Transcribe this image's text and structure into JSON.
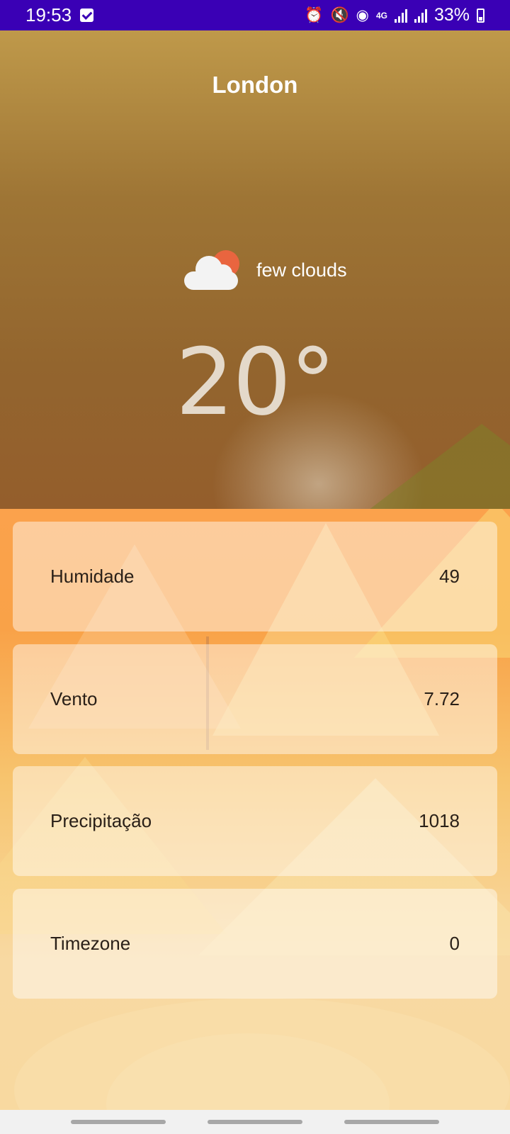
{
  "status_bar": {
    "time": "19:53",
    "network": "4G",
    "battery": "33%",
    "icons": [
      "task-check-icon",
      "alarm-icon",
      "mute-icon",
      "hotspot-icon",
      "signal-icon",
      "signal-icon",
      "battery-charging-icon"
    ]
  },
  "weather": {
    "city": "London",
    "condition": "few clouds",
    "condition_icon": "cloud-sun-icon",
    "temperature": "20°"
  },
  "details": [
    {
      "label": "Humidade",
      "value": "49"
    },
    {
      "label": "Vento",
      "value": "7.72"
    },
    {
      "label": "Precipitação",
      "value": "1018"
    },
    {
      "label": "Timezone",
      "value": "0"
    }
  ],
  "colors": {
    "status_bar": "#3a00b5",
    "top_background": "#93652e",
    "bottom_background": "#f9a248",
    "sun": "#e9653f",
    "cloud": "#f3f3f3"
  }
}
